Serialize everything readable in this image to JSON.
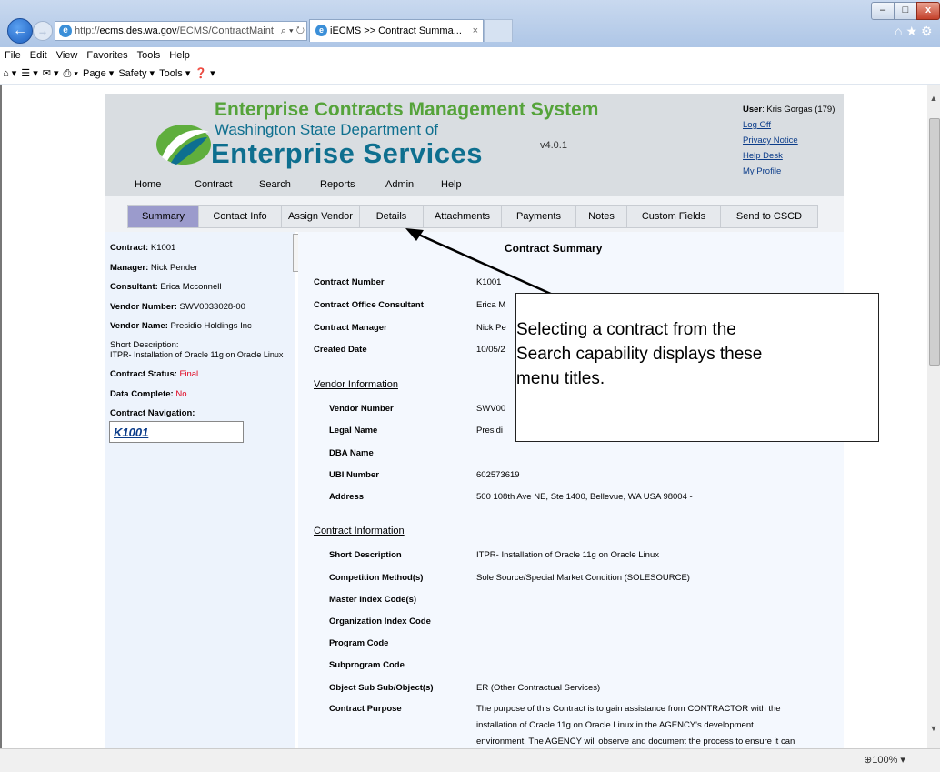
{
  "browser": {
    "url_prefix": "http://",
    "url_domain": "ecms.des.wa.gov",
    "url_path": "/ECMS/ContractMaint",
    "url_controls": "⌕ ▾ ↻",
    "tab_title": "iECMS >> Contract Summa...",
    "tab_close": "×",
    "window_min": "–",
    "window_max": "□",
    "window_close": "x",
    "toolbar_icons": "⌂★⚙",
    "menu": [
      "File",
      "Edit",
      "View",
      "Favorites",
      "Tools",
      "Help"
    ],
    "commands": [
      "⌂ ▾",
      "☰ ▾",
      "✉ ▾",
      "⎙ ▾",
      "Page ▾",
      "Safety ▾",
      "Tools ▾",
      "❓ ▾"
    ],
    "zoom": "⊕100%  ▾"
  },
  "header": {
    "system_title": "Enterprise Contracts Management System",
    "dept_line1": "Washington State Department of",
    "dept_line2": "Enterprise Services",
    "version": "v4.0.1",
    "user_label": "User",
    "user_value": ": Kris Gorgas (179)",
    "links": [
      "Log Off",
      "Privacy Notice",
      "Help Desk",
      "My Profile"
    ],
    "nav": [
      "Home",
      "Contract",
      "Search",
      "Reports",
      "Admin",
      "Help"
    ]
  },
  "tabs": [
    "Summary",
    "Contact Info",
    "Assign Vendor",
    "Details",
    "Attachments",
    "Payments",
    "Notes",
    "Custom Fields",
    "Send to CSCD"
  ],
  "left": {
    "contract_label": "Contract:",
    "contract_value": "K1001",
    "manager_label": "Manager:",
    "manager_value": "Nick Pender",
    "consultant_label": "Consultant:",
    "consultant_value": "Erica Mcconnell",
    "vendor_number_label": "Vendor Number:",
    "vendor_number_value": "SWV0033028-00",
    "vendor_name_label": "Vendor Name:",
    "vendor_name_value": "Presidio Holdings Inc",
    "short_desc_label": "Short Description:",
    "short_desc_value": "ITPR- Installation of Oracle 11g on Oracle Linux",
    "status_label": "Contract Status:",
    "status_value": "Final",
    "complete_label": "Data Complete:",
    "complete_value": "No",
    "nav_label": "Contract Navigation:",
    "nav_value": "K1001"
  },
  "summary": {
    "title": "Contract Summary",
    "rows": [
      {
        "label": "Contract Number",
        "value": "K1001"
      },
      {
        "label": "Contract Office Consultant",
        "value": "Erica M"
      },
      {
        "label": "Contract Manager",
        "value": "Nick Pe"
      },
      {
        "label": "Created Date",
        "value": "10/05/2"
      }
    ],
    "vendor_section": "Vendor Information",
    "vendor_rows": [
      {
        "label": "Vendor Number",
        "value": "SWV00"
      },
      {
        "label": "Legal Name",
        "value": "Presidi"
      },
      {
        "label": "DBA Name",
        "value": ""
      },
      {
        "label": "UBI Number",
        "value": "602573619"
      },
      {
        "label": "Address",
        "value": "500 108th Ave NE, Ste 1400, Bellevue, WA USA 98004 -"
      }
    ],
    "contract_section": "Contract Information",
    "contract_rows": [
      {
        "label": "Short Description",
        "value": "ITPR- Installation of Oracle 11g on Oracle Linux"
      },
      {
        "label": "Competition Method(s)",
        "value": "Sole Source/Special Market Condition (SOLESOURCE)"
      },
      {
        "label": "Master Index Code(s)",
        "value": ""
      },
      {
        "label": "Organization Index Code",
        "value": ""
      },
      {
        "label": "Program Code",
        "value": ""
      },
      {
        "label": "Subprogram Code",
        "value": ""
      },
      {
        "label": "Object Sub Sub/Object(s)",
        "value": "ER (Other Contractual Services)"
      },
      {
        "label": "Contract Purpose",
        "value": "The purpose of this Contract is to gain assistance from CONTRACTOR with the"
      }
    ],
    "purpose_line2": "installation of Oracle 11g on Oracle Linux in the AGENCY's development",
    "purpose_line3": "environment. The AGENCY will observe and document the process to ensure it can"
  },
  "callout": {
    "line1": "Selecting a contract from the",
    "line2": "Search capability displays these",
    "line3": "menu titles."
  },
  "colors": {
    "active_tab": "#9b9bcc",
    "title_green": "#55a33a",
    "dept_teal": "#0e6f8f",
    "status_red": "#e0001b"
  }
}
